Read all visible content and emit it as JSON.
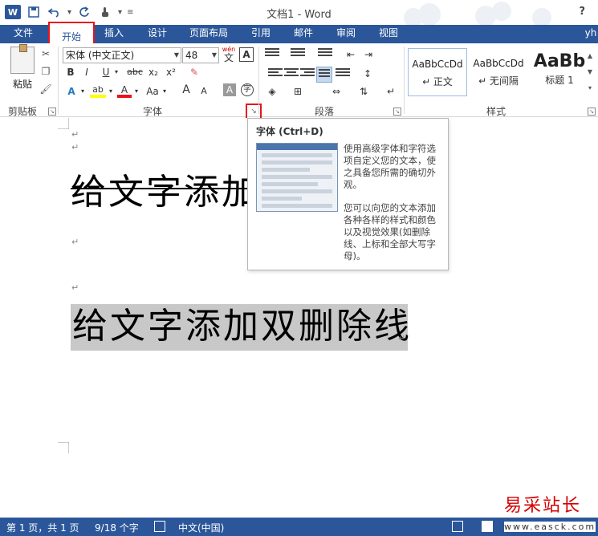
{
  "app": {
    "title": "文档1 - Word",
    "help": "?",
    "user": "yh",
    "logo": "W"
  },
  "qat": {
    "icons": [
      "word-icon",
      "save-icon",
      "undo-icon",
      "redo-icon",
      "touch-mode-icon",
      "customize-icon"
    ]
  },
  "tabs": [
    {
      "label": "文件"
    },
    {
      "label": "开始"
    },
    {
      "label": "插入"
    },
    {
      "label": "设计"
    },
    {
      "label": "页面布局"
    },
    {
      "label": "引用"
    },
    {
      "label": "邮件"
    },
    {
      "label": "审阅"
    },
    {
      "label": "视图"
    }
  ],
  "ribbon": {
    "clipboard": {
      "label": "剪贴板",
      "paste": "粘贴"
    },
    "font": {
      "label": "字体",
      "name": "宋体 (中文正文)",
      "size": "48",
      "wen": "wén",
      "wen_char": "文",
      "a_box": "A",
      "bold": "B",
      "italic": "I",
      "underline": "U",
      "strike": "abc",
      "subscript": "x₂",
      "superscript": "x²",
      "effects": "A",
      "highlight": "ab",
      "font_color": "A",
      "change_case": "Aa",
      "grow": "A",
      "shrink": "A",
      "char_shading": "A",
      "enclose": "字"
    },
    "paragraph": {
      "label": "段落"
    },
    "styles": {
      "label": "样式",
      "items": [
        {
          "sample": "AaBbCcDd",
          "name": "↵ 正文"
        },
        {
          "sample": "AaBbCcDd",
          "name": "↵ 无间隔"
        },
        {
          "sample": "AaBb",
          "name": "标题 1"
        }
      ]
    }
  },
  "tooltip": {
    "title": "字体 (Ctrl+D)",
    "desc1": "使用高级字体和字符选项自定义您的文本，使之具备您所需的确切外观。",
    "desc2": "您可以向您的文本添加各种各样的样式和颜色以及视觉效果(如删除线、上标和全部大写字母)。"
  },
  "document": {
    "line1": "给文字添加",
    "line2": "给文字添加双删除线",
    "para_mark": "↵"
  },
  "status": {
    "page": "第 1 页，共 1 页",
    "words": "9/18 个字",
    "lang": "中文(中国)"
  },
  "watermark": {
    "cn": "易采站长站",
    "url": "www.easck.com"
  },
  "colors": {
    "brand": "#2b579a",
    "highlight_red": "#e8141b",
    "selection": "#c8c8c8"
  }
}
